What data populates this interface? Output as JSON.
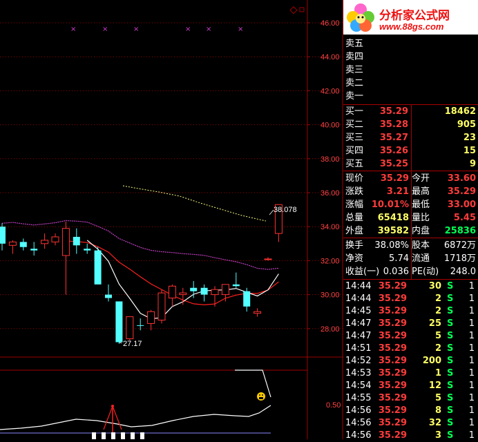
{
  "logo": {
    "title": "分析家公式网",
    "url": "www.88gs.com"
  },
  "chart_data": {
    "type": "candlestick",
    "price_axis": {
      "ticks": [
        "46.00",
        "44.00",
        "42.00",
        "40.00",
        "38.00",
        "36.00",
        "34.00",
        "32.00",
        "30.00",
        "28.00"
      ],
      "ylim": [
        27.0,
        46.5
      ]
    },
    "candles": [
      {
        "o": 34.0,
        "h": 34.2,
        "l": 32.6,
        "c": 33.0,
        "up": false
      },
      {
        "o": 32.9,
        "h": 33.2,
        "l": 32.4,
        "c": 33.1,
        "up": true
      },
      {
        "o": 33.1,
        "h": 33.3,
        "l": 32.6,
        "c": 32.8,
        "up": false
      },
      {
        "o": 32.6,
        "h": 33.1,
        "l": 32.3,
        "c": 32.7,
        "up": false
      },
      {
        "o": 33.0,
        "h": 33.6,
        "l": 32.7,
        "c": 33.2,
        "up": true
      },
      {
        "o": 33.1,
        "h": 33.6,
        "l": 32.9,
        "c": 33.4,
        "up": true
      },
      {
        "o": 32.3,
        "h": 34.3,
        "l": 30.0,
        "c": 33.9,
        "up": true
      },
      {
        "o": 33.4,
        "h": 33.9,
        "l": 32.4,
        "c": 32.9,
        "up": false
      },
      {
        "o": 32.7,
        "h": 33.0,
        "l": 32.4,
        "c": 32.6,
        "up": false
      },
      {
        "o": 32.6,
        "h": 32.8,
        "l": 30.6,
        "c": 30.6,
        "up": false
      },
      {
        "o": 30.0,
        "h": 30.6,
        "l": 29.6,
        "c": 29.8,
        "up": false
      },
      {
        "o": 29.6,
        "h": 29.6,
        "l": 27.1,
        "c": 27.2,
        "up": false
      },
      {
        "o": 27.4,
        "h": 28.7,
        "l": 27.3,
        "c": 28.7,
        "up": true
      },
      {
        "o": 28.2,
        "h": 28.6,
        "l": 27.9,
        "c": 28.2,
        "up": false
      },
      {
        "o": 28.3,
        "h": 29.1,
        "l": 27.9,
        "c": 29.0,
        "up": true
      },
      {
        "o": 28.5,
        "h": 30.3,
        "l": 28.3,
        "c": 30.1,
        "up": true
      },
      {
        "o": 29.8,
        "h": 30.6,
        "l": 29.3,
        "c": 30.5,
        "up": true
      },
      {
        "o": 30.0,
        "h": 30.4,
        "l": 29.4,
        "c": 30.1,
        "up": true
      },
      {
        "o": 30.2,
        "h": 30.8,
        "l": 29.8,
        "c": 30.4,
        "up": false
      },
      {
        "o": 30.4,
        "h": 30.6,
        "l": 29.6,
        "c": 30.0,
        "up": false
      },
      {
        "o": 30.0,
        "h": 30.5,
        "l": 29.3,
        "c": 30.3,
        "up": true
      },
      {
        "o": 30.0,
        "h": 30.6,
        "l": 29.6,
        "c": 30.6,
        "up": true
      },
      {
        "o": 30.6,
        "h": 31.3,
        "l": 30.4,
        "c": 30.5,
        "up": false
      },
      {
        "o": 30.2,
        "h": 30.4,
        "l": 29.0,
        "c": 29.3,
        "up": false
      },
      {
        "o": 29.0,
        "h": 29.2,
        "l": 28.7,
        "c": 28.9,
        "up": true
      },
      {
        "o": 32.1,
        "h": 32.2,
        "l": 32.0,
        "c": 32.1,
        "up": true
      },
      {
        "o": 33.6,
        "h": 35.3,
        "l": 33.1,
        "c": 35.3,
        "up": true
      }
    ],
    "annotations": {
      "high_label": "38.078",
      "low_label": "27.17"
    },
    "indicator_axis": {
      "ticks": [
        "0.50"
      ]
    }
  },
  "sell_labels": [
    "卖五",
    "卖四",
    "卖三",
    "卖二",
    "卖一"
  ],
  "buy": [
    {
      "label": "买一",
      "price": "35.29",
      "vol": "18462"
    },
    {
      "label": "买二",
      "price": "35.28",
      "vol": "905"
    },
    {
      "label": "买三",
      "price": "35.27",
      "vol": "23"
    },
    {
      "label": "买四",
      "price": "35.26",
      "vol": "15"
    },
    {
      "label": "买五",
      "price": "35.25",
      "vol": "9"
    }
  ],
  "quote": [
    {
      "l1": "现价",
      "v1": "35.29",
      "l2": "今开",
      "v2": "33.60"
    },
    {
      "l1": "涨跌",
      "v1": "3.21",
      "l2": "最高",
      "v2": "35.29"
    },
    {
      "l1": "涨幅",
      "v1": "10.01%",
      "l2": "最低",
      "v2": "33.00"
    },
    {
      "l1": "总量",
      "v1": "65418",
      "l2": "量比",
      "v2": "5.45"
    },
    {
      "l1": "外盘",
      "v1": "39582",
      "l2": "内盘",
      "v2": "25836"
    }
  ],
  "fund": [
    {
      "l1": "换手",
      "v1": "38.08%",
      "l2": "股本",
      "v2": "6872万"
    },
    {
      "l1": "净资",
      "v1": "5.74",
      "l2": "流通",
      "v2": "1718万"
    },
    {
      "l1": "收益(一)",
      "v1": "0.036",
      "l2": "PE(动)",
      "v2": "248.0"
    }
  ],
  "ticks": [
    {
      "t": "14:44",
      "p": "35.29",
      "v": "30",
      "s": "S",
      "n": "1"
    },
    {
      "t": "14:44",
      "p": "35.29",
      "v": "2",
      "s": "S",
      "n": "1"
    },
    {
      "t": "14:45",
      "p": "35.29",
      "v": "2",
      "s": "S",
      "n": "1"
    },
    {
      "t": "14:47",
      "p": "35.29",
      "v": "25",
      "s": "S",
      "n": "1"
    },
    {
      "t": "14:47",
      "p": "35.29",
      "v": "5",
      "s": "S",
      "n": "1"
    },
    {
      "t": "14:51",
      "p": "35.29",
      "v": "2",
      "s": "S",
      "n": "1"
    },
    {
      "t": "14:52",
      "p": "35.29",
      "v": "200",
      "s": "S",
      "n": "1"
    },
    {
      "t": "14:53",
      "p": "35.29",
      "v": "1",
      "s": "S",
      "n": "1"
    },
    {
      "t": "14:54",
      "p": "35.29",
      "v": "12",
      "s": "S",
      "n": "1"
    },
    {
      "t": "14:55",
      "p": "35.29",
      "v": "5",
      "s": "S",
      "n": "1"
    },
    {
      "t": "14:56",
      "p": "35.29",
      "v": "8",
      "s": "S",
      "n": "1"
    },
    {
      "t": "14:56",
      "p": "35.29",
      "v": "32",
      "s": "S",
      "n": "1"
    },
    {
      "t": "14:56",
      "p": "35.29",
      "v": "3",
      "s": "S",
      "n": "1"
    }
  ],
  "colors": {
    "up": "#ff3333",
    "down": "#54ffff",
    "ma5": "#ffffff",
    "ma10": "#ff2020",
    "ma20": "#c040c0",
    "ma60": "#ffff80",
    "grid": "#a00000"
  }
}
